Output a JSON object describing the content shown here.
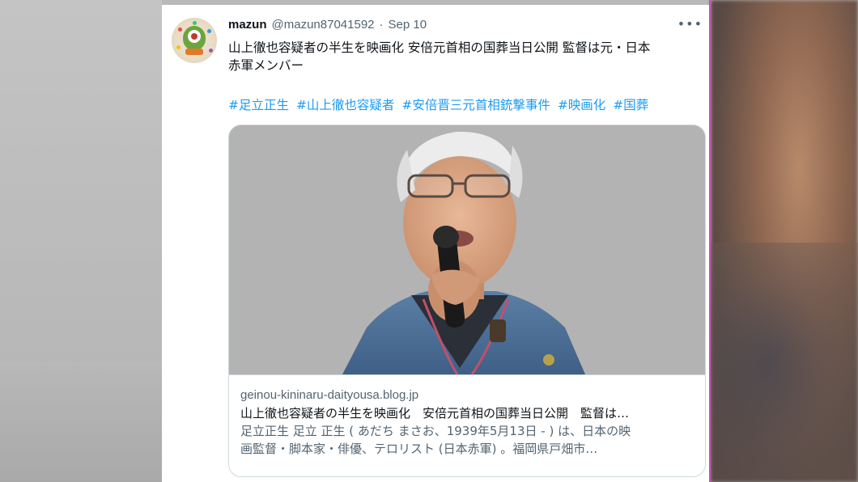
{
  "tweet": {
    "display_name": "mazun",
    "handle": "@mazun87041592",
    "separator": "·",
    "date": "Sep 10",
    "more_icon": "more-options-icon",
    "text_line1": "山上徹也容疑者の半生を映画化 安倍元首相の国葬当日公開 監督は元・日本",
    "text_line2": "赤軍メンバー",
    "hashtags": [
      "#足立正生",
      "#山上徹也容疑者",
      "#安倍晋三元首相銃撃事件",
      "#映画化",
      "#国葬"
    ]
  },
  "link_card": {
    "domain": "geinou-kininaru-daityousa.blog.jp",
    "title": "山上徹也容疑者の半生を映画化　安倍元首相の国葬当日公開　監督は…",
    "description_line1": "足立正生 足立 正生 ( あだち まさお、1939年5月13日 - ) は、日本の映",
    "description_line2": "画監督・脚本家・俳優、テロリスト (日本赤軍) 。福岡県戸畑市…"
  },
  "colors": {
    "link_blue": "#1d9bf0",
    "text_primary": "#0f1419",
    "text_secondary": "#536471",
    "border": "#cfd9de",
    "accent_edge": "#d946b8"
  }
}
